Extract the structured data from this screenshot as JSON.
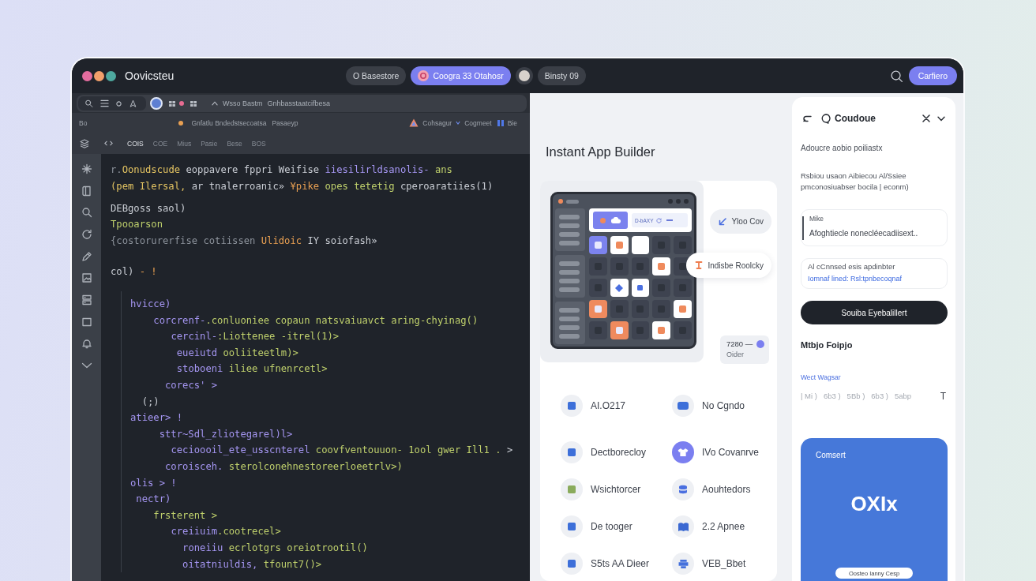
{
  "window": {
    "title": "Oovicsteu"
  },
  "top_bar": {
    "pills": [
      {
        "label": "O Basestore",
        "selected": false
      },
      {
        "label": "Coogra 33 Otahosr",
        "selected": true
      },
      {
        "label": "Binsty 09",
        "selected": false
      }
    ],
    "action_button": "Carfiero"
  },
  "editor": {
    "toolbar": {
      "labels": [
        "Wsso Bastm",
        "Gnhbasstaatcifbesa"
      ]
    },
    "path_bar": {
      "prefix": "Bo",
      "file": "Gnfatlu Bndedstsecoatsa",
      "tag": "Pasaeyp",
      "status": [
        "Cohsagur",
        "Cogmeet",
        "Bie"
      ]
    },
    "tabs": [
      {
        "label": "COIS",
        "selected": true
      },
      {
        "label": "COE",
        "selected": false
      },
      {
        "label": "Mius",
        "selected": false
      },
      {
        "label": "Pasie",
        "selected": false
      },
      {
        "label": "Bese",
        "selected": false
      },
      {
        "label": "BOS",
        "selected": false
      }
    ],
    "code": {
      "blocks": [
        {
          "lines": [
            {
              "tokens": [
                {
                  "text": "r.",
                  "kind": "muted"
                },
                {
                  "text": "Oonudscude",
                  "kind": "yellow"
                },
                {
                  "text": " eoppavere fppri Weifise ",
                  "kind": "plain"
                },
                {
                  "text": "iiesilirldsanolis-",
                  "kind": "keyword"
                },
                {
                  "text": " ans",
                  "kind": "string"
                }
              ]
            },
            {
              "tokens": [
                {
                  "text": "(pem Ilersal,",
                  "kind": "yellow"
                },
                {
                  "text": " ar tnalerroanic»",
                  "kind": "plain"
                },
                {
                  "text": " ¥pike",
                  "kind": "accent"
                },
                {
                  "text": " opes tetetig",
                  "kind": "string"
                },
                {
                  "text": " cperoaratiies(1)",
                  "kind": "plain"
                }
              ]
            }
          ]
        },
        {
          "lines": [
            {
              "tokens": [
                {
                  "text": "DEBgoss saol)",
                  "kind": "plain"
                }
              ]
            },
            {
              "tokens": [
                {
                  "text": "Tpooarson",
                  "kind": "string"
                }
              ]
            },
            {
              "tokens": [
                {
                  "text": "{costorurerfise cotiissen",
                  "kind": "muted"
                },
                {
                  "text": " Ulidoic",
                  "kind": "accent"
                },
                {
                  "text": " IY soiofash»",
                  "kind": "plain"
                }
              ]
            }
          ]
        },
        {
          "lines": [
            {
              "tokens": [
                {
                  "text": "col)",
                  "kind": "plain"
                },
                {
                  "text": " - !",
                  "kind": "accent"
                }
              ]
            }
          ]
        },
        {
          "lines": [
            {
              "tokens": [
                {
                  "text": "hvicce)",
                  "kind": "keyword"
                }
              ]
            },
            {
              "tokens": [
                {
                  "text": "    corcrenf-",
                  "kind": "keyword"
                },
                {
                  "text": ".conluoniee copaun natsvaiuavct aring-chyinag()",
                  "kind": "string"
                }
              ]
            },
            {
              "tokens": [
                {
                  "text": "       cercinl-",
                  "kind": "keyword"
                },
                {
                  "text": ":Liottenee -itrel(1)>",
                  "kind": "string"
                }
              ]
            },
            {
              "tokens": [
                {
                  "text": "        eueiutd",
                  "kind": "keyword"
                },
                {
                  "text": " ooliiteetlm)>",
                  "kind": "string"
                }
              ]
            },
            {
              "tokens": [
                {
                  "text": "        stoboeni",
                  "kind": "keyword"
                },
                {
                  "text": " iliee ufnenrcetl>",
                  "kind": "string"
                }
              ]
            },
            {
              "tokens": [
                {
                  "text": "      corecs' >",
                  "kind": "keyword"
                }
              ]
            },
            {
              "tokens": [
                {
                  "text": "  (;)",
                  "kind": "plain"
                }
              ]
            },
            {
              "tokens": [
                {
                  "text": "atieer> !",
                  "kind": "keyword"
                }
              ]
            },
            {
              "tokens": [
                {
                  "text": "     sttr~Sdl_zliotegarel)l>",
                  "kind": "keyword"
                }
              ]
            },
            {
              "tokens": [
                {
                  "text": "       cecioooil_ete_usscnterel",
                  "kind": "keyword"
                },
                {
                  "text": " coovfventouuon- 1ool gwer Ill1 .",
                  "kind": "string"
                },
                {
                  "text": " >",
                  "kind": "plain"
                }
              ]
            },
            {
              "tokens": [
                {
                  "text": "      coroisceh.",
                  "kind": "keyword"
                },
                {
                  "text": " sterolconehnestoreerloeetrlv>)",
                  "kind": "string"
                }
              ]
            },
            {
              "tokens": [
                {
                  "text": "olis > !",
                  "kind": "keyword"
                }
              ]
            },
            {
              "tokens": [
                {
                  "text": " nectr)",
                  "kind": "keyword"
                }
              ]
            },
            {
              "tokens": [
                {
                  "text": "    frsterent >",
                  "kind": "string"
                }
              ]
            },
            {
              "tokens": [
                {
                  "text": "       creiiuim",
                  "kind": "keyword"
                },
                {
                  "text": ".cootrecel>",
                  "kind": "string"
                }
              ]
            },
            {
              "tokens": [
                {
                  "text": "         roneiiu",
                  "kind": "keyword"
                },
                {
                  "text": " ecrlotgrs oreiotrootil()",
                  "kind": "string"
                }
              ]
            },
            {
              "tokens": [
                {
                  "text": "         oitatniuldis,",
                  "kind": "keyword"
                },
                {
                  "text": " tfount7()>",
                  "kind": "string"
                }
              ]
            }
          ]
        }
      ]
    }
  },
  "builder": {
    "title": "Instant App Builder",
    "mockup": {
      "label": "D-bAXY",
      "tiles": [
        {
          "color": "#7c83ee",
          "kind": "square"
        },
        {
          "color": "#ffffff",
          "kind": "square"
        },
        {
          "color": "#ffffff",
          "kind": "blank"
        },
        {
          "color": "#3e4350",
          "kind": "square"
        },
        {
          "color": "#3e4350",
          "kind": "square"
        },
        {
          "color": "#3e4350",
          "kind": "square"
        },
        {
          "color": "#3e4350",
          "kind": "square"
        },
        {
          "color": "#3e4350",
          "kind": "square"
        },
        {
          "color": "#ffffff",
          "kind": "square"
        },
        {
          "color": "#3e4350",
          "kind": "square"
        },
        {
          "color": "#3e4350",
          "kind": "square"
        },
        {
          "color": "#ffffff",
          "kind": "diamond"
        },
        {
          "color": "#ffffff",
          "kind": "dot"
        },
        {
          "color": "#3e4350",
          "kind": "square"
        },
        {
          "color": "#3e4350",
          "kind": "square"
        },
        {
          "color": "#ef8a5e",
          "kind": "square"
        },
        {
          "color": "#3e4350",
          "kind": "square"
        },
        {
          "color": "#3e4350",
          "kind": "square"
        },
        {
          "color": "#3e4350",
          "kind": "square"
        },
        {
          "color": "#ffffff",
          "kind": "square"
        },
        {
          "color": "#3e4350",
          "kind": "square"
        },
        {
          "color": "#ef8a5e",
          "kind": "square"
        },
        {
          "color": "#3e4350",
          "kind": "square"
        },
        {
          "color": "#ffffff",
          "kind": "square"
        },
        {
          "color": "#3e4350",
          "kind": "square"
        }
      ]
    },
    "chips": [
      {
        "label": "Yloo Cov",
        "color": "#4b6fe0"
      },
      {
        "label": "Indisbe Roolcky",
        "color": "#ef7d4f"
      }
    ],
    "stat": {
      "value": "7280 —",
      "label": "Oider"
    },
    "features": [
      {
        "label": "AI.O217",
        "color": "#3d6fd9",
        "selected": false
      },
      {
        "label": "No Cgndo",
        "color": "#3d6fd9",
        "selected": false
      },
      {
        "label": "Dectborecloy",
        "color": "#3d6fd9",
        "selected": false
      },
      {
        "label": "IVo Covanrve",
        "color": "#7b7ff0",
        "selected": true
      },
      {
        "label": "Wsichtorcer",
        "color": "#8aab5c",
        "selected": false
      },
      {
        "label": "Aouhtedors",
        "color": "#4a6fe0",
        "selected": false
      },
      {
        "label": "De tooger",
        "color": "#3d6fd9",
        "selected": false
      },
      {
        "label": "2.2 Apnee",
        "color": "#3a68d2",
        "selected": false
      },
      {
        "label": "S5ts AA Dieer",
        "color": "#3d6fd9",
        "selected": false
      },
      {
        "label": "VEB_Bbet",
        "color": "#4470dc",
        "selected": false
      }
    ]
  },
  "assistant": {
    "title": "Coudoue",
    "subtitle": "Adoucre aobio poiliastx",
    "description": "Rsbiou usaon Aibiecou Al/Ssiee pmconosiuabser bocila | econm)",
    "field": {
      "label": "Mike",
      "value": "Afoghtiecle nonecléecadiisext.."
    },
    "info": {
      "text": "Al cCnnsed esis apdinbter",
      "link": "Iomnaf lined: Rsl:tpnbecoqnaf"
    },
    "primary_button": "Souiba Eyebalillert",
    "section_title": "Mtbjo Foipjo",
    "section_link": "Wect Wagsar",
    "tags": [
      "| Mi )",
      "6b3 )",
      "5Bb )",
      "6b3 )",
      "5abp"
    ],
    "tool": "T",
    "promo": {
      "caption": "Comsert",
      "logo": "OXIx",
      "button": "Oosteo Ianny Cesp"
    }
  }
}
